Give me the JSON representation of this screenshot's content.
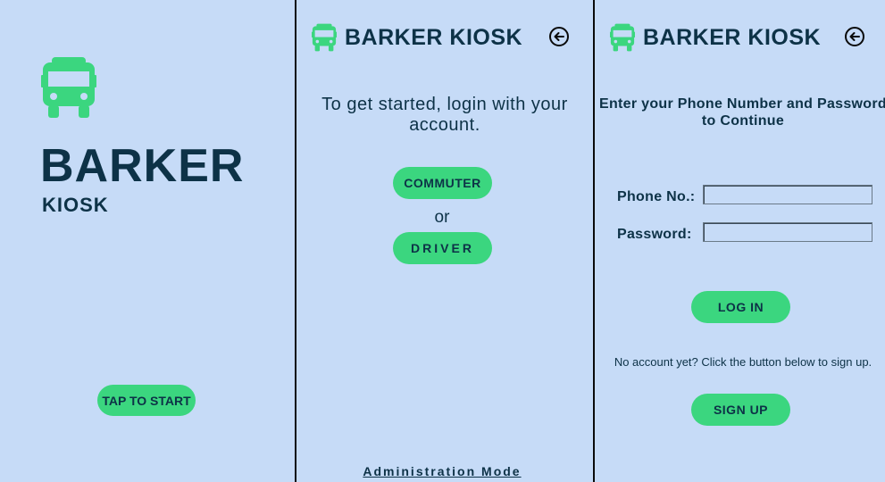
{
  "splash": {
    "brand_title": "BARKER",
    "brand_subtitle": "KIOSK",
    "tap_to_start": "TAP TO START",
    "icon": "bus-icon"
  },
  "login_choice": {
    "header_title": "BARKER KIOSK",
    "intro": "To get started, login with your account.",
    "commuter_button": "COMMUTER",
    "or_text": "or",
    "driver_button": "DRIVER",
    "admin_link": "Administration Mode",
    "back_icon": "back-arrow-icon"
  },
  "login_form": {
    "header_title": "BARKER KIOSK",
    "prompt": "Enter your Phone Number and Password to Continue",
    "phone_label": "Phone No.:",
    "phone_value": "",
    "password_label": "Password:",
    "password_value": "",
    "login_button": "LOG IN",
    "signup_note": "No account yet? Click the button below to sign up.",
    "signup_button": "SIGN UP",
    "back_icon": "back-arrow-icon"
  },
  "colors": {
    "background": "#c6dbf7",
    "accent": "#3bd67f",
    "text": "#0d3247",
    "divider": "#0a0a0a"
  }
}
